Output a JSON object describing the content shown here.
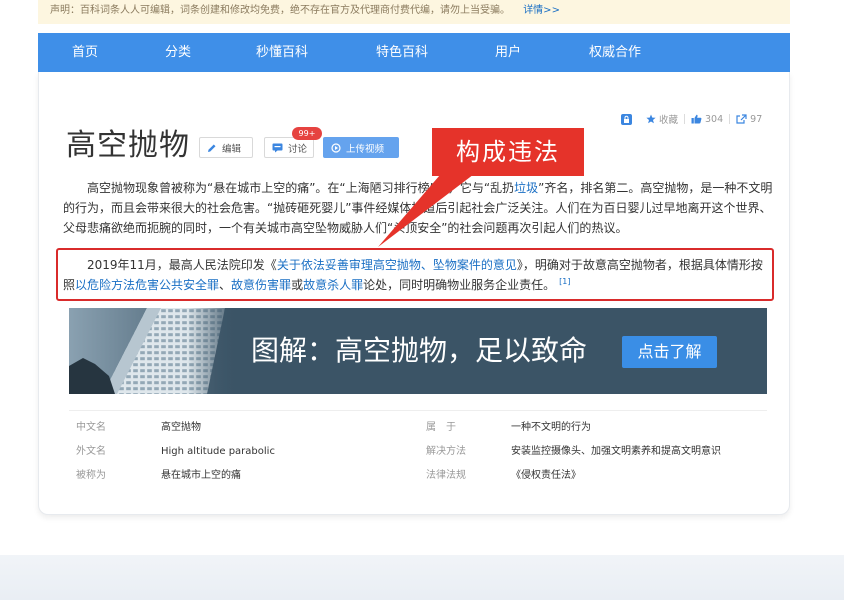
{
  "notice": {
    "text": "声明：百科词条人人可编辑，词条创建和修改均免费，绝不存在官方及代理商付费代编，请勿上当受骗。",
    "link_label": "详情>>"
  },
  "nav": {
    "items": [
      {
        "label": "首页"
      },
      {
        "label": "分类"
      },
      {
        "label": "秒懂百科"
      },
      {
        "label": "特色百科"
      },
      {
        "label": "用户"
      },
      {
        "label": "权威合作"
      }
    ]
  },
  "tools": {
    "favorite_label": "收藏",
    "like_count": "304",
    "share_count": "97"
  },
  "entry": {
    "title": "高空抛物",
    "edit_label": "编辑",
    "discuss_label": "讨论",
    "discuss_badge": "99+",
    "upload_video_label": "上传视频"
  },
  "annotation": {
    "label": "构成违法"
  },
  "summary": {
    "segments": [
      "高空抛物现象曾被称为“悬在城市上空的痛”。在“上海陋习排行榜”中，它与“乱扔",
      "垃圾",
      "”齐名，排名第二。高空抛物，是一种不文明的行为，而且会带来很大的社会危害。“抛砖砸死婴儿”事件经媒体报道后引起社会广泛关注。人们在为百日婴儿过早地离开这个世界、父母悲痛欲绝而扼腕的同时，一个有关城市高空坠物威胁人们“头顶安全”的社会问题再次引起人们的热议。"
    ]
  },
  "legal": {
    "segments": [
      "2019年11月，最高人民法院印发《",
      "关于依法妥善审理高空抛物、坠物案件的意见",
      "》，明确对于故意高空抛物者，根据具体情形按照",
      "以危险方法危害公共安全罪",
      "、",
      "故意伤害罪",
      "或",
      "故意杀人罪",
      "论处，同时明确物业服务企业责任。"
    ],
    "citation": "[1]"
  },
  "banner": {
    "title": "图解：高空抛物，足以致命",
    "button_label": "点击了解"
  },
  "basic_info": {
    "rows": [
      {
        "label_left": "中文名",
        "value_left": "高空抛物",
        "label_right": "属　于",
        "value_right": "一种不文明的行为"
      },
      {
        "label_left": "外文名",
        "value_left": "High altitude parabolic",
        "label_right": "解决方法",
        "value_right": "安装监控摄像头、加强文明素养和提高文明意识"
      },
      {
        "label_left": "被称为",
        "value_left": "悬在城市上空的痛",
        "label_right": "法律法规",
        "value_right": "《侵权责任法》"
      }
    ]
  },
  "icons": {
    "lock": "lock-icon",
    "favorite": "star-icon",
    "like": "thumbs-up-icon",
    "share": "share-icon",
    "edit": "pencil-icon",
    "discuss": "chat-icon",
    "upload": "play-circle-icon"
  },
  "colors": {
    "notice-bg": "#fdf6e0",
    "nav-bg": "#3f8fe8",
    "link": "#1a6fc4",
    "annotation": "#e5332a",
    "banner-bg": "#3b5466",
    "banner-button": "#3a8ee6",
    "upload-button": "#65a3ee",
    "badge": "#e64340"
  }
}
